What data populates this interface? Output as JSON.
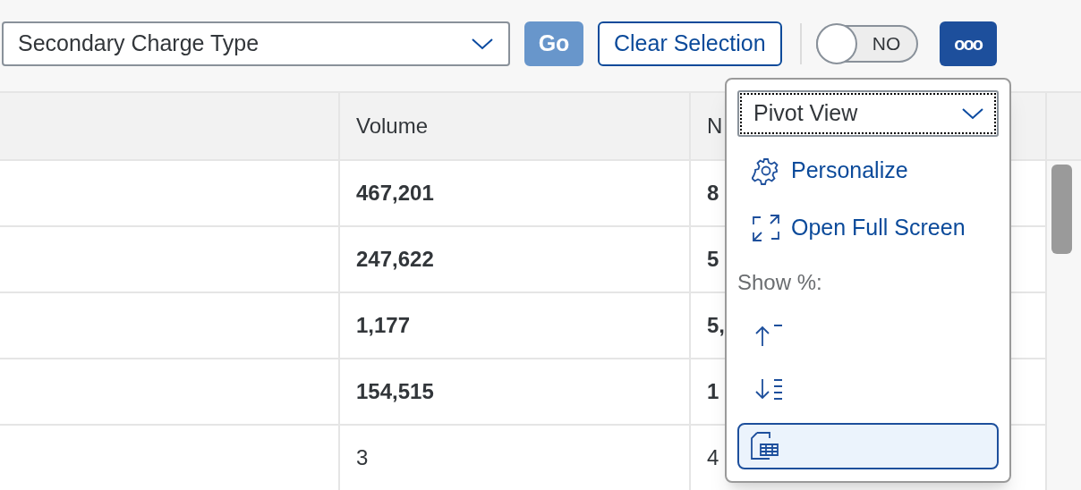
{
  "toolbar": {
    "select": {
      "value": "Secondary Charge Type"
    },
    "go_button": {
      "label": "Go",
      "disabled": true
    },
    "clear_button": {
      "label": "Clear Selection"
    },
    "toggle": {
      "label": "NO",
      "on": false
    },
    "more_button": {
      "label": "ooo"
    }
  },
  "table": {
    "columns": [
      "",
      "Volume",
      "N"
    ],
    "rows": [
      {
        "cells": [
          "",
          "467,201",
          "8"
        ],
        "emphasized": true
      },
      {
        "cells": [
          "",
          "247,622",
          "5"
        ],
        "emphasized": true
      },
      {
        "cells": [
          "",
          "1,177",
          "5,"
        ],
        "emphasized": true
      },
      {
        "cells": [
          "",
          "154,515",
          "1"
        ],
        "emphasized": true
      },
      {
        "cells": [
          "",
          "3",
          "4"
        ],
        "emphasized": false
      }
    ]
  },
  "popover": {
    "view_select": {
      "value": "Pivot View"
    },
    "items": [
      {
        "kind": "action",
        "label": "Personalize"
      },
      {
        "kind": "action",
        "label": "Open Full Screen"
      },
      {
        "kind": "heading",
        "label": "Show %:"
      },
      {
        "kind": "icon",
        "selected": false
      },
      {
        "kind": "icon",
        "selected": false
      },
      {
        "kind": "icon",
        "selected": true
      }
    ]
  }
}
